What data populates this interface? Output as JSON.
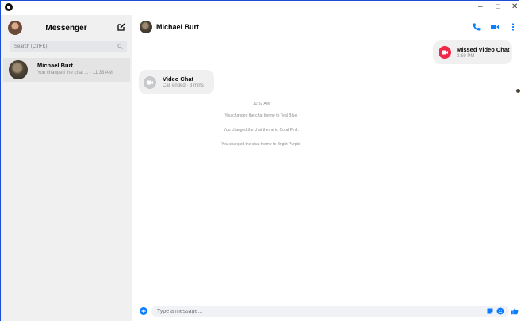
{
  "window": {
    "min_label": "–",
    "max_label": "□",
    "close_label": "✕"
  },
  "sidebar": {
    "title": "Messenger",
    "search_placeholder": "Search (Ctrl+K)",
    "conversations": [
      {
        "name": "Michael Burt",
        "snippet": "You changed the chat ... · 11:33 AM"
      }
    ]
  },
  "chat": {
    "contact_name": "Michael Burt",
    "messages": {
      "missed": {
        "title": "Missed Video Chat",
        "time": "3:59 PM"
      },
      "video": {
        "title": "Video Chat",
        "subtitle": "Call ended · 3 mins"
      }
    },
    "timestamp": "11:32 AM",
    "system_messages": [
      "You changed the chat theme to Teal Blue.",
      "You changed the chat theme to Coral Pink.",
      "You changed the chat theme to Bright Purple."
    ],
    "composer_placeholder": "Type a message..."
  },
  "colors": {
    "accent": "#0a7cff",
    "missed_red": "#f02849",
    "bubble_gray": "#f0f0f0"
  },
  "icons": [
    "messenger-icon",
    "compose-icon",
    "search-icon",
    "phone-icon",
    "video-camera-icon",
    "more-options-icon",
    "add-icon",
    "sticker-icon",
    "emoji-icon",
    "thumbs-up-icon"
  ]
}
